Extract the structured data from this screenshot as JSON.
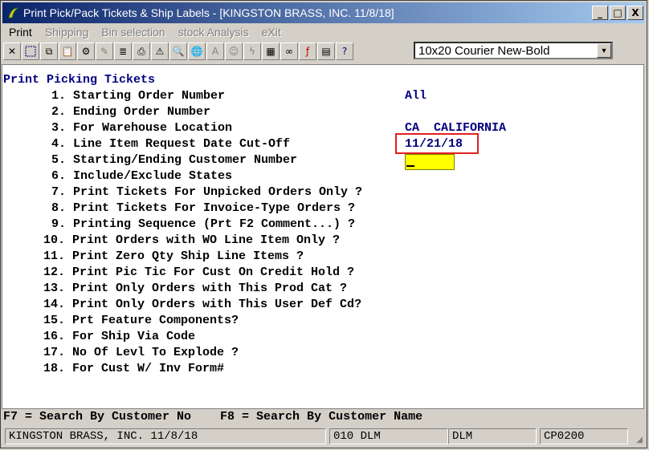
{
  "window": {
    "title": "Print Pick/Pack Tickets & Ship Labels - [KINGSTON BRASS, INC. 11/8/18]",
    "minimize_label": "_",
    "maximize_label": "□",
    "close_label": "X"
  },
  "menu": [
    {
      "label": "Print",
      "enabled": true
    },
    {
      "label": "Shipping",
      "enabled": false
    },
    {
      "label": "Bin selection",
      "enabled": false
    },
    {
      "label": "stock Analysis",
      "enabled": false
    },
    {
      "label": "eXit",
      "enabled": false
    }
  ],
  "toolbar": {
    "font_selector": "10x20 Courier New-Bold"
  },
  "screen": {
    "heading": "Print Picking Tickets",
    "options": [
      "1. Starting Order Number",
      "2. Ending Order Number",
      "3. For Warehouse Location",
      "4. Line Item Request Date Cut-Off",
      "5. Starting/Ending Customer Number",
      "6. Include/Exclude States",
      "7. Print Tickets For Unpicked Orders Only ?",
      "8. Print Tickets For Invoice-Type Orders ?",
      "9. Printing Sequence (Prt F2 Comment...) ?",
      "10. Print Orders with WO Line Item Only ?",
      "11. Print Zero Qty Ship Line Items ?",
      "12. Print Pic Tic For Cust On Credit Hold ?",
      "13. Print Only Orders with This Prod Cat ?",
      "14. Print Only Orders with This User Def Cd?",
      "15. Prt Feature Components?",
      "16. For Ship Via Code",
      "17. No Of Levl To Explode ?",
      "18. For Cust W/ Inv Form#"
    ],
    "values": {
      "starting_order": "All",
      "warehouse": "CA  CALIFORNIA",
      "cutoff_date": "11/21/18"
    },
    "hint": "F7 = Search By Customer No    F8 = Search By Customer Name"
  },
  "status": {
    "company": "KINGSTON BRASS, INC. 11/8/18",
    "user_code": "010 DLM",
    "user": "DLM",
    "program": "CP0200"
  }
}
